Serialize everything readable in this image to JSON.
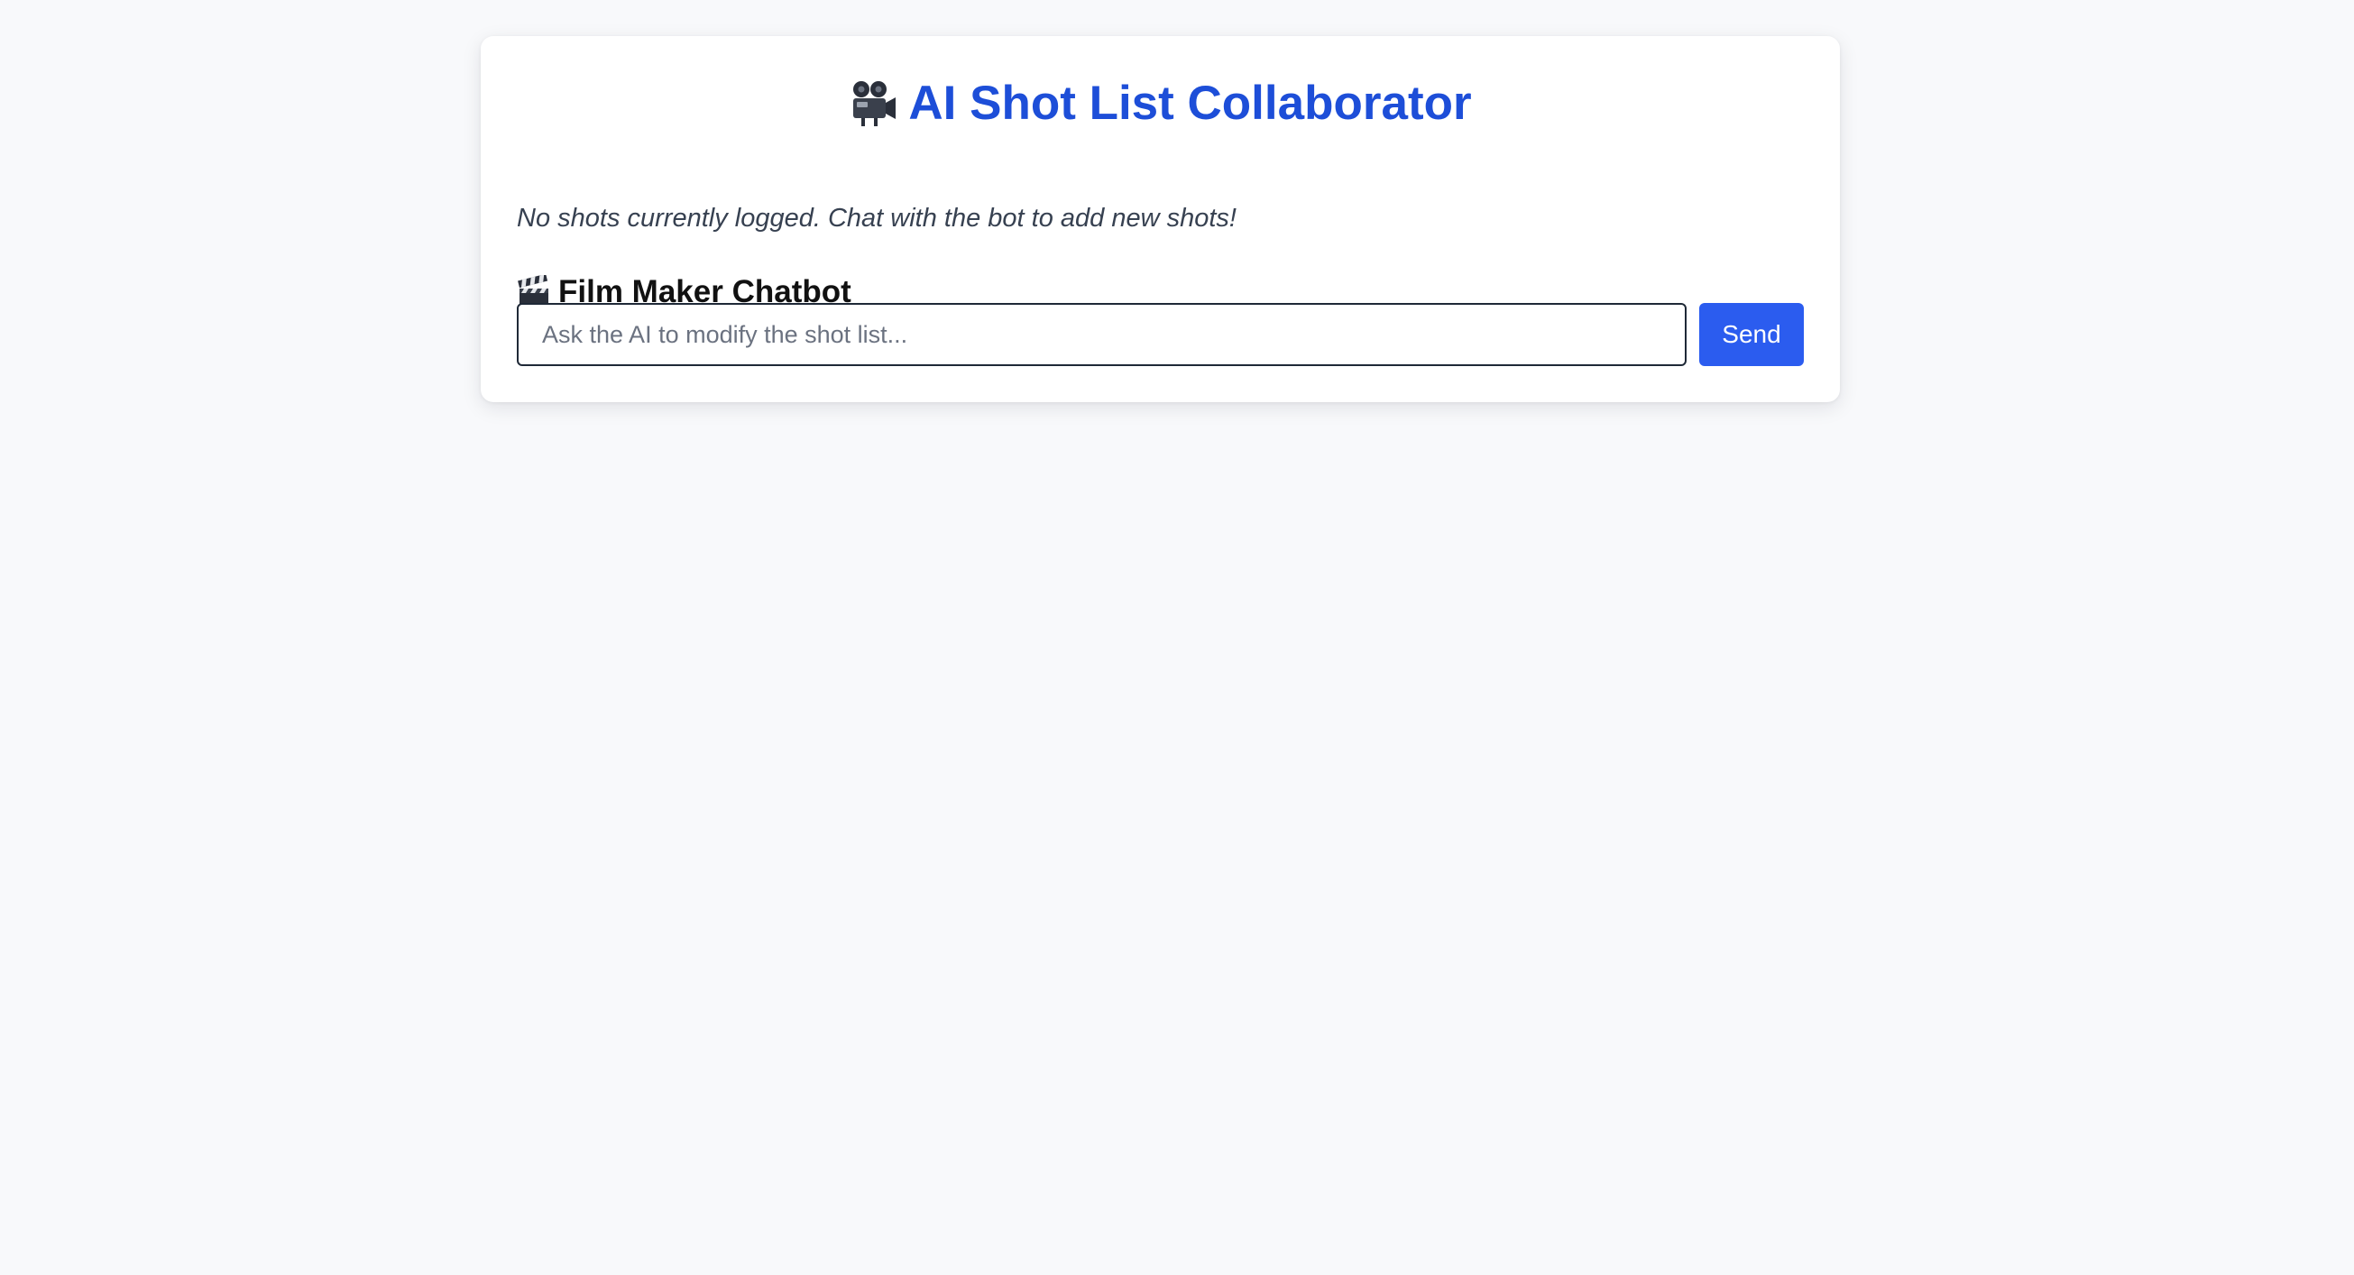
{
  "header": {
    "title": "AI Shot List Collaborator",
    "title_icon": "movie-camera-icon",
    "title_color": "#1d4ed8"
  },
  "shot_list": {
    "empty_message": "No shots currently logged. Chat with the bot to add new shots!"
  },
  "chatbot": {
    "section_title": "Film Maker Chatbot",
    "section_icon": "clapper-board-icon",
    "input_value": "",
    "input_placeholder": "Ask the AI to modify the shot list...",
    "send_label": "Send",
    "send_color": "#2b5cef"
  }
}
